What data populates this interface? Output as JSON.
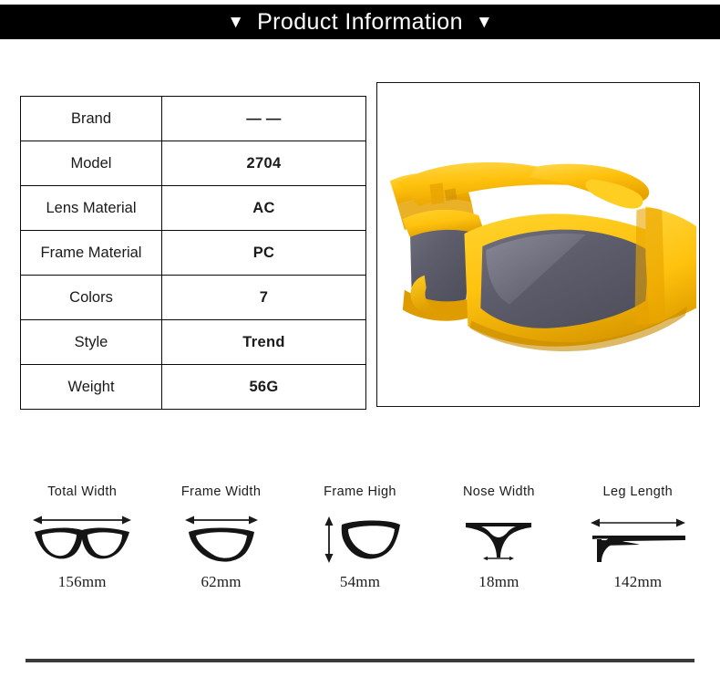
{
  "header": {
    "title": "Product Information",
    "left_triangle": "▼",
    "right_triangle": "▼",
    "background_color": "#000000",
    "text_color": "#ffffff"
  },
  "spec_table": {
    "rows": [
      {
        "key": "Brand",
        "value": "— —"
      },
      {
        "key": "Model",
        "value": "2704"
      },
      {
        "key": "Lens Material",
        "value": "AC"
      },
      {
        "key": "Frame Material",
        "value": "PC"
      },
      {
        "key": "Colors",
        "value": "7"
      },
      {
        "key": "Style",
        "value": "Trend"
      },
      {
        "key": "Weight",
        "value": "56G"
      }
    ]
  },
  "product_image": {
    "alt": "yellow wrap-around sport sunglasses, three-quarter view",
    "frame_color": "#FFC20E",
    "frame_shadow_color": "#E09E00",
    "frame_highlight_color": "#FFD84D",
    "lens_color": "#61616F",
    "background_color": "#ffffff",
    "border_color": "#111111"
  },
  "measurements": [
    {
      "label": "Total Width",
      "value": "156mm",
      "icon": "glasses-full-frame-icon"
    },
    {
      "label": "Frame Width",
      "value": "62mm",
      "icon": "glasses-single-lens-width-icon"
    },
    {
      "label": "Frame High",
      "value": "54mm",
      "icon": "glasses-single-lens-height-icon"
    },
    {
      "label": "Nose Width",
      "value": "18mm",
      "icon": "glasses-nose-bridge-icon"
    },
    {
      "label": "Leg Length",
      "value": "142mm",
      "icon": "glasses-temple-arm-icon"
    }
  ],
  "footer": {
    "rule_color": "#3a3a3a"
  }
}
